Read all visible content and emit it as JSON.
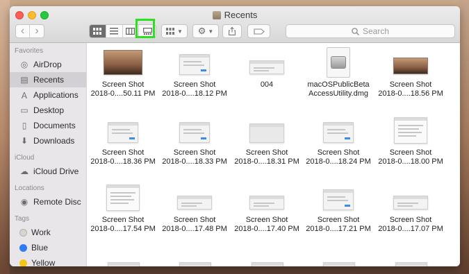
{
  "window": {
    "title": "Recents"
  },
  "toolbar": {
    "back_icon": "‹",
    "forward_icon": "›",
    "view_icons": [
      "icon-view-icon",
      "list-view-icon",
      "column-view-icon",
      "gallery-view-icon"
    ],
    "search_placeholder": "Search"
  },
  "sidebar": {
    "sections": [
      {
        "title": "Favorites",
        "items": [
          {
            "label": "AirDrop",
            "icon": "airdrop-icon",
            "glyph": "◎"
          },
          {
            "label": "Recents",
            "icon": "recents-icon",
            "glyph": "▤",
            "selected": true
          },
          {
            "label": "Applications",
            "icon": "applications-icon",
            "glyph": "Ａ"
          },
          {
            "label": "Desktop",
            "icon": "desktop-icon",
            "glyph": "▭"
          },
          {
            "label": "Documents",
            "icon": "documents-icon",
            "glyph": "▯"
          },
          {
            "label": "Downloads",
            "icon": "downloads-icon",
            "glyph": "⬇"
          }
        ]
      },
      {
        "title": "iCloud",
        "items": [
          {
            "label": "iCloud Drive",
            "icon": "cloud-icon",
            "glyph": "☁"
          }
        ]
      },
      {
        "title": "Locations",
        "items": [
          {
            "label": "Remote Disc",
            "icon": "disc-icon",
            "glyph": "◉"
          }
        ]
      },
      {
        "title": "Tags",
        "items": [
          {
            "label": "Work",
            "icon": "tag-work-icon",
            "color": "#d8d4cf"
          },
          {
            "label": "Blue",
            "icon": "tag-blue-icon",
            "color": "#2f7bf5"
          },
          {
            "label": "Yellow",
            "icon": "tag-yellow-icon",
            "color": "#f5c518"
          }
        ]
      }
    ]
  },
  "files": [
    {
      "line1": "Screen Shot",
      "line2": "2018-0....50.11 PM",
      "kind": "desktop"
    },
    {
      "line1": "Screen Shot",
      "line2": "2018-0....18.12 PM",
      "kind": "dialog"
    },
    {
      "line1": "004",
      "line2": "",
      "kind": "wide"
    },
    {
      "line1": "macOSPublicBeta",
      "line2": "AccessUtility.dmg",
      "kind": "dmg"
    },
    {
      "line1": "Screen Shot",
      "line2": "2018-0....18.56 PM",
      "kind": "desktop-small"
    },
    {
      "line1": "Screen Shot",
      "line2": "2018-0....18.36 PM",
      "kind": "dialog"
    },
    {
      "line1": "Screen Shot",
      "line2": "2018-0....18.33 PM",
      "kind": "dialog"
    },
    {
      "line1": "Screen Shot",
      "line2": "2018-0....18.31 PM",
      "kind": "blank"
    },
    {
      "line1": "Screen Shot",
      "line2": "2018-0....18.24 PM",
      "kind": "dialog"
    },
    {
      "line1": "Screen Shot",
      "line2": "2018-0....18.00 PM",
      "kind": "doc"
    },
    {
      "line1": "Screen Shot",
      "line2": "2018-0....17.54 PM",
      "kind": "doc"
    },
    {
      "line1": "Screen Shot",
      "line2": "2018-0....17.48 PM",
      "kind": "wide"
    },
    {
      "line1": "Screen Shot",
      "line2": "2018-0....17.40 PM",
      "kind": "wide"
    },
    {
      "line1": "Screen Shot",
      "line2": "2018-0....17.21 PM",
      "kind": "dialog"
    },
    {
      "line1": "Screen Shot",
      "line2": "2018-0....17.07 PM",
      "kind": "wide"
    }
  ]
}
